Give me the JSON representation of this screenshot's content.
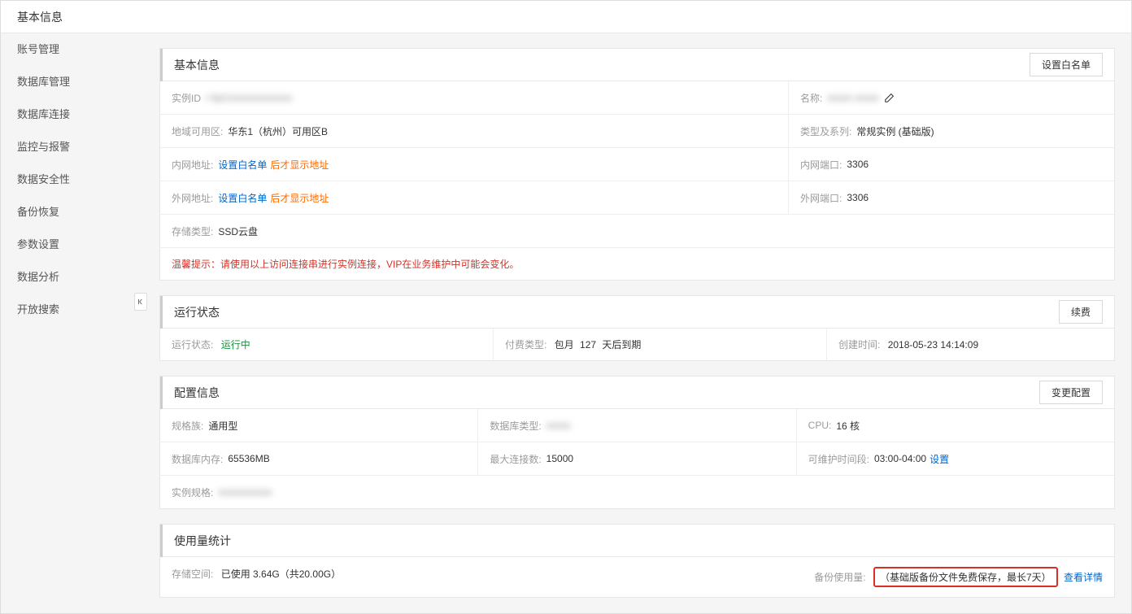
{
  "topbar": {
    "title": "基本信息"
  },
  "sidebar": {
    "items": [
      {
        "label": "账号管理"
      },
      {
        "label": "数据库管理"
      },
      {
        "label": "数据库连接"
      },
      {
        "label": "监控与报警"
      },
      {
        "label": "数据安全性"
      },
      {
        "label": "备份恢复"
      },
      {
        "label": "参数设置"
      },
      {
        "label": "数据分析"
      },
      {
        "label": "开放搜索"
      }
    ]
  },
  "basic": {
    "title": "基本信息",
    "whitelist_btn": "设置白名单",
    "instance_id_label": "实例ID",
    "instance_id_value": "r-bp1xxxxxxxxxxxxx",
    "name_label": "名称:",
    "name_value": "xxxxx xxxxx",
    "region_label": "地域可用区:",
    "region_value": "华东1（杭州）可用区B",
    "type_label": "类型及系列:",
    "type_value": "常规实例 (基础版)",
    "intranet_addr_label": "内网地址:",
    "intranet_addr_link": "设置白名单",
    "intranet_addr_after": "后才显示地址",
    "intranet_port_label": "内网端口:",
    "intranet_port_value": "3306",
    "extranet_addr_label": "外网地址:",
    "extranet_addr_link": "设置白名单",
    "extranet_addr_after": "后才显示地址",
    "extranet_port_label": "外网端口:",
    "extranet_port_value": "3306",
    "storage_label": "存储类型:",
    "storage_value": "SSD云盘",
    "warm_tip": "温馨提示：请使用以上访问连接串进行实例连接，VIP在业务维护中可能会变化。"
  },
  "run": {
    "title": "运行状态",
    "renew_btn": "续费",
    "status_label": "运行状态:",
    "status_value": "运行中",
    "paytype_label": "付费类型:",
    "paytype_prefix": "包月",
    "paytype_days": "127",
    "paytype_suffix": "天后到期",
    "create_label": "创建时间:",
    "create_value": "2018-05-23 14:14:09"
  },
  "config": {
    "title": "配置信息",
    "change_btn": "变更配置",
    "family_label": "规格族:",
    "family_value": "通用型",
    "dbtype_label": "数据库类型:",
    "dbtype_value": "xxxxx",
    "cpu_label": "CPU:",
    "cpu_value": "16 核",
    "mem_label": "数据库内存:",
    "mem_value": "65536MB",
    "maxconn_label": "最大连接数:",
    "maxconn_value": "15000",
    "maint_label": "可维护时间段:",
    "maint_value": "03:00-04:00",
    "maint_set": "设置",
    "spec_label": "实例规格:",
    "spec_value": "xxxxxxxxxxx"
  },
  "usage": {
    "title": "使用量统计",
    "storage_label": "存储空间:",
    "storage_value": "已使用 3.64G（共20.00G）",
    "backup_label": "备份使用量:",
    "backup_note": "（基础版备份文件免费保存，最长7天）",
    "backup_detail": "查看详情"
  }
}
